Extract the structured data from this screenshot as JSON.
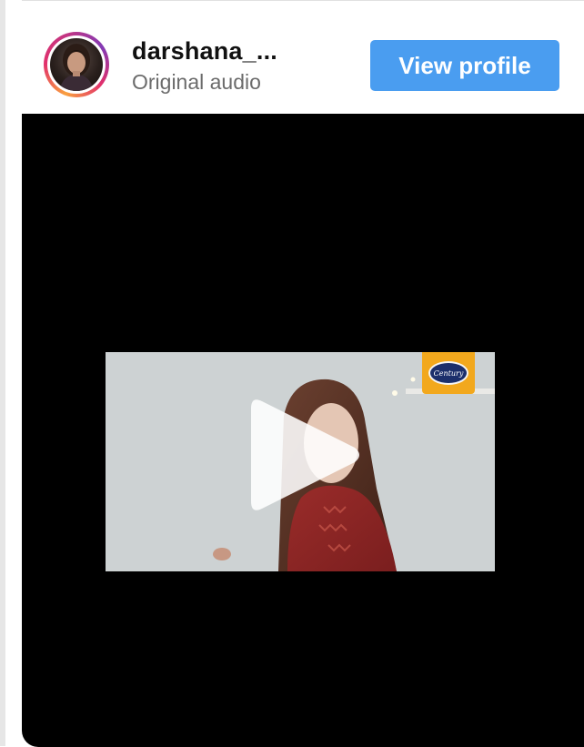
{
  "post": {
    "username": "darshana_...",
    "audio_label": "Original audio",
    "view_profile_label": "View profile"
  },
  "video": {
    "brand_badge_text": "Century",
    "state": "paused"
  },
  "colors": {
    "button_bg": "#4a9df0",
    "player_bg": "#000000",
    "badge": "#f2a81d"
  },
  "icons": {
    "play": "play-icon",
    "avatar": "avatar"
  }
}
